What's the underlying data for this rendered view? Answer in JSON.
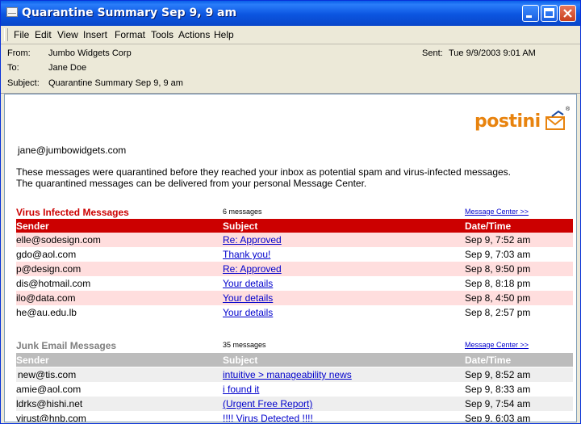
{
  "window": {
    "title": "Quarantine Summary Sep 9, 9 am"
  },
  "menu": [
    "File",
    "Edit",
    "View",
    "Insert",
    "Format",
    "Tools",
    "Actions",
    "Help"
  ],
  "headers": {
    "from_label": "From:",
    "from": "Jumbo Widgets Corp",
    "to_label": "To:",
    "to": "Jane Doe",
    "subject_label": "Subject:",
    "subject": "Quarantine Summary Sep 9, 9 am",
    "sent_label": "Sent:",
    "sent": "Tue 9/9/2003 9:01 AM"
  },
  "logo": {
    "text": "postini",
    "mark": "®"
  },
  "email": {
    "recipient": "jane@jumbowidgets.com",
    "intro_1": "These messages were quarantined before they reached your inbox as potential spam and virus-infected messages.",
    "intro_2": "The quarantined messages can be delivered from your personal Message Center."
  },
  "virus": {
    "title": "Virus Infected Messages",
    "count": "6 messages",
    "link": "Message Center >>",
    "columns": [
      "Sender",
      "Subject",
      "Date/Time"
    ],
    "rows": [
      {
        "sender": "elle@sodesign.com",
        "subject": "Re: Approved",
        "date": "Sep 9, 7:52 am"
      },
      {
        "sender": "gdo@aol.com",
        "subject": "Thank you!",
        "date": "Sep 9, 7:03 am"
      },
      {
        "sender": "p@design.com",
        "subject": "Re: Approved",
        "date": "Sep 8, 9:50 pm"
      },
      {
        "sender": "dis@hotmail.com",
        "subject": "Your details",
        "date": "Sep 8, 8:18 pm"
      },
      {
        "sender": "ilo@data.com",
        "subject": "Your details",
        "date": "Sep 8, 4:50 pm"
      },
      {
        "sender": "he@au.edu.lb",
        "subject": "Your details",
        "date": "Sep 8, 2:57 pm"
      }
    ]
  },
  "junk": {
    "title": "Junk Email Messages",
    "count": "35 messages",
    "link": "Message Center >>",
    "columns": [
      "Sender",
      "Subject",
      "Date/Time"
    ],
    "rows": [
      {
        "sender": "new@tis.com",
        "subject": "intuitive > manageability news",
        "date": "Sep 9, 8:52 am"
      },
      {
        "sender": "amie@aol.com",
        "subject": "i found it",
        "date": "Sep 9, 8:33 am"
      },
      {
        "sender": "ldrks@hishi.net",
        "subject": "(Urgent Free Report)",
        "date": "Sep 9, 7:54 am"
      },
      {
        "sender": "virust@hnb.com",
        "subject": "!!!! Virus Detected !!!!",
        "date": "Sep 9, 6:03 am"
      }
    ]
  },
  "colors": {
    "virus_header": "#cc0000",
    "virus_row": "#ffdede",
    "junk_header": "#bcbcbc",
    "junk_row": "#eeeeee",
    "link": "#0000cc"
  }
}
